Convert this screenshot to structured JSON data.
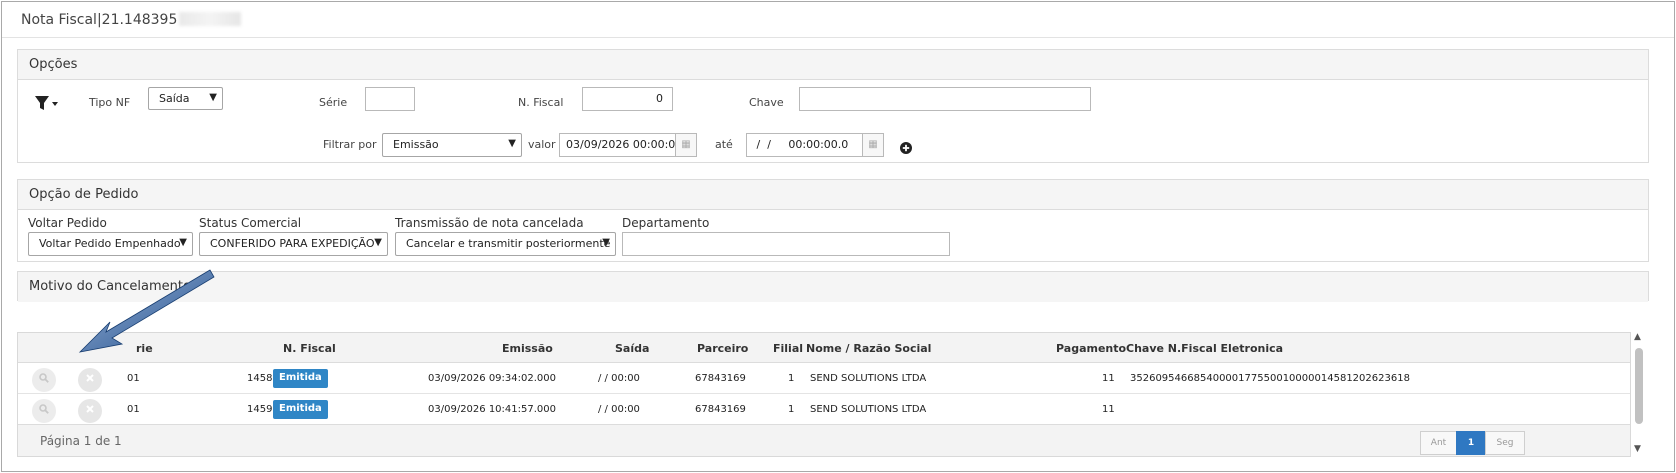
{
  "window": {
    "title": "Nota Fiscal|21.148395"
  },
  "opcoes": {
    "header": "Opções",
    "filter_icon": "filter-icon",
    "tipo_nf": {
      "label": "Tipo NF",
      "value": "Saída"
    },
    "serie": {
      "label": "Série",
      "value": ""
    },
    "n_fiscal": {
      "label": "N. Fiscal",
      "value": "0"
    },
    "chave": {
      "label": "Chave",
      "value": ""
    },
    "filtrar_por": {
      "label": "Filtrar por",
      "value": "Emissão"
    },
    "valor": {
      "label": "valor",
      "value": "03/09/2026 00:00:0"
    },
    "ate": {
      "label": "até",
      "value": " /  /     00:00:00.0"
    },
    "add_icon": "plus-circle-icon"
  },
  "opcao_pedido": {
    "header": "Opção de Pedido",
    "voltar_pedido": {
      "label": "Voltar Pedido",
      "value": "Voltar Pedido Empenhado"
    },
    "status_comercial": {
      "label": "Status Comercial",
      "value": "CONFERIDO PARA EXPEDIÇÃO"
    },
    "transmissao": {
      "label": "Transmissão de nota cancelada",
      "value": "Cancelar e transmitir posteriormente"
    },
    "departamento": {
      "label": "Departamento",
      "value": ""
    }
  },
  "motivo": {
    "header": "Motivo do Cancelamento"
  },
  "grid": {
    "columns": {
      "serie": "rie",
      "n_fiscal": "N. Fiscal",
      "emissao": "Emissão",
      "saida": "Saída",
      "parceiro": "Parceiro",
      "filial": "Filial",
      "nome": "Nome / Razão Social",
      "pagamento": "Pagamento",
      "chave": "Chave N.Fiscal Eletronica"
    },
    "rows": [
      {
        "serie": "01",
        "n_fiscal": "1458",
        "status": "Emitida",
        "emissao": "03/09/2026 09:34:02.000",
        "saida": "/ / 00:00",
        "parceiro": "67843169",
        "filial": "1",
        "nome": "SEND SOLUTIONS LTDA",
        "pagamento": "11",
        "chave": "35260954668540000177550010000014581202623618"
      },
      {
        "serie": "01",
        "n_fiscal": "1459",
        "status": "Emitida",
        "emissao": "03/09/2026 10:41:57.000",
        "saida": "/ / 00:00",
        "parceiro": "67843169",
        "filial": "1",
        "nome": "SEND SOLUTIONS LTDA",
        "pagamento": "11",
        "chave": ""
      }
    ],
    "footer": {
      "page_info": "Página 1 de 1",
      "prev": "Ant",
      "current": "1",
      "next": "Seg"
    }
  },
  "colors": {
    "accent": "#2f86c6",
    "arrow": "#1f4e8c"
  }
}
